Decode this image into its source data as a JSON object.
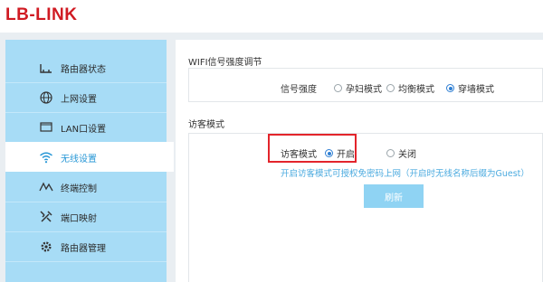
{
  "header": {
    "logo_text": "LB-LINK",
    "brand_color": "#d01a22"
  },
  "sidebar": {
    "items": [
      {
        "label": "路由器状态",
        "icon": "router-icon",
        "active": false
      },
      {
        "label": "上网设置",
        "icon": "globe-icon",
        "active": false
      },
      {
        "label": "LAN口设置",
        "icon": "monitor-icon",
        "active": false
      },
      {
        "label": "无线设置",
        "icon": "wifi-icon",
        "active": true
      },
      {
        "label": "终端控制",
        "icon": "signal-wave-icon",
        "active": false
      },
      {
        "label": "端口映射",
        "icon": "tools-icon",
        "active": false
      },
      {
        "label": "路由器管理",
        "icon": "gear-icon",
        "active": false
      }
    ],
    "background_color": "#a7dcf6",
    "active_color": "#2797d6"
  },
  "wifi_strength": {
    "section_title": "WIFI信号强度调节",
    "label": "信号强度",
    "options": [
      "孕妇模式",
      "均衡模式",
      "穿墙模式"
    ],
    "selected": "穿墙模式"
  },
  "guest_mode": {
    "section_title": "访客模式",
    "label": "访客模式",
    "options": [
      "开启",
      "关闭"
    ],
    "selected": "开启",
    "hint": "开启访客模式可授权免密码上网（开启时无线名称后缀为Guest）",
    "refresh_label": "刷新"
  }
}
